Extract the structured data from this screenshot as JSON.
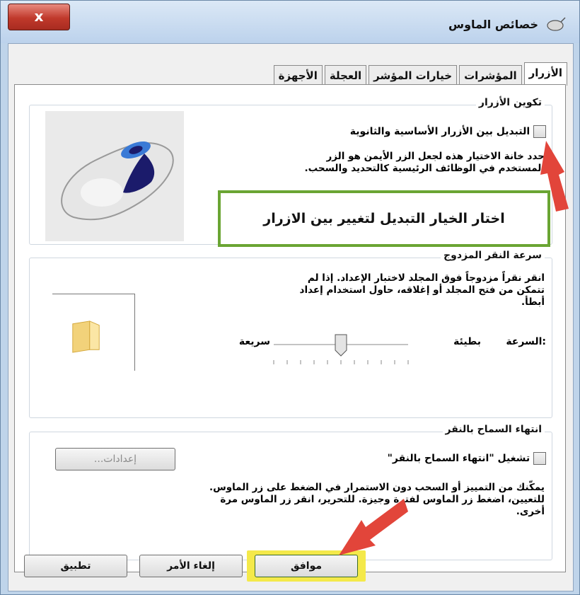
{
  "window": {
    "title": "خصائص الماوس",
    "close_label": "x"
  },
  "tabs": [
    "الأزرار",
    "المؤشرات",
    "خيارات المؤشر",
    "العجلة",
    "الأجهزة"
  ],
  "button_config": {
    "title": "تكوين الأزرار",
    "checkbox_label": "التبديل بين الأزرار الأساسية والثانوية",
    "description_line1": "حدد خانة الاختيار هذه لجعل الزر الأيمن هو الزر",
    "description_line2": "المستخدم في الوظائف الرئيسية كالتحديد والسحب."
  },
  "annotation": {
    "text": "اختار الخيار التبديل لتغيير بين الازرار",
    "box_color": "#6aa533",
    "arrow_color": "#e2453a"
  },
  "double_click": {
    "title": "سرعة النقر المزدوج",
    "description_line1": "انقر نقراً مزدوجاً فوق المجلد لاختبار الإعداد. إذا لم",
    "description_line2": "تتمكن من فتح المجلد أو إغلاقه، حاول استخدام إعداد",
    "description_line3": "أبطأ.",
    "speed_label": "السرعة:",
    "slow_label": "بطيئة",
    "fast_label": "سريعة",
    "speed_level": 0.5
  },
  "click_lock": {
    "title": "انتهاء السماح بالنقر",
    "checkbox_label": "تشغيل \"انتهاء السماح بالنقر\"",
    "settings_label": "إعدادات...",
    "description_line1": "يمكّنك من التمييز أو السحب دون الاستمرار في الضغط على زر الماوس.",
    "description_line2": "للتعيين، اضغط زر الماوس لفترة وجيزة. للتحرير، انقر زر الماوس مرة",
    "description_line3": "أخرى."
  },
  "footer": {
    "ok_label": "موافق",
    "cancel_label": "إلغاء الأمر",
    "apply_label": "تطبيق",
    "highlight_color": "#f4e94a"
  }
}
